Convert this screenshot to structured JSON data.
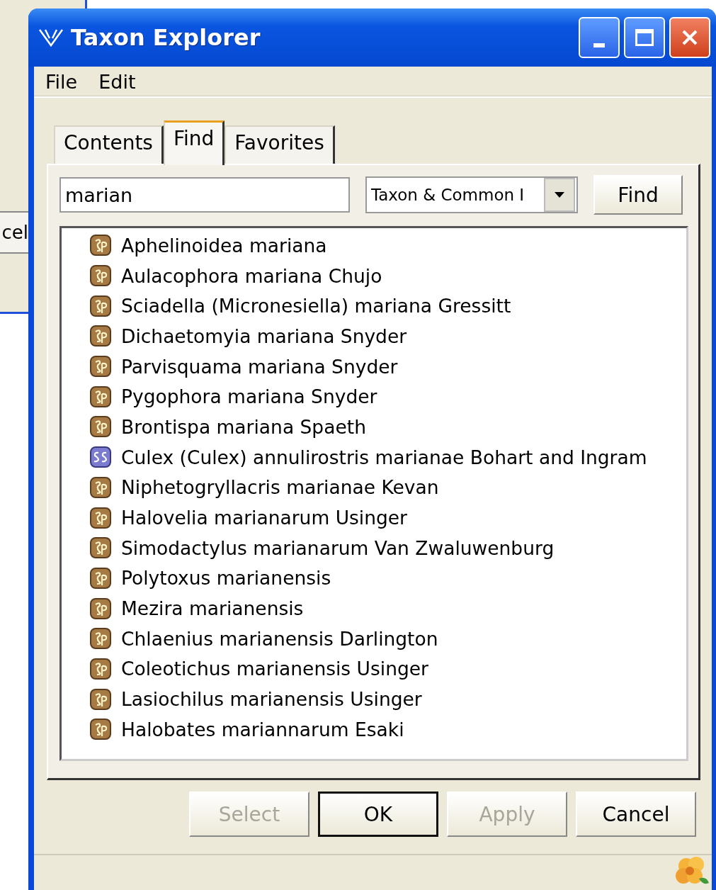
{
  "background_window": {
    "button_text": "cel"
  },
  "window": {
    "title": "Taxon Explorer"
  },
  "menu": [
    "File",
    "Edit"
  ],
  "tabs": [
    {
      "label": "Contents",
      "selected": false
    },
    {
      "label": "Find",
      "selected": true
    },
    {
      "label": "Favorites",
      "selected": false
    }
  ],
  "search": {
    "value": "marian"
  },
  "scope_dropdown": {
    "value": "Taxon & Common I"
  },
  "find_button": "Find",
  "results": [
    {
      "kind": "sp",
      "name": "Aphelinoidea mariana"
    },
    {
      "kind": "sp",
      "name": "Aulacophora mariana Chujo"
    },
    {
      "kind": "sp",
      "name": "Sciadella (Micronesiella) mariana Gressitt"
    },
    {
      "kind": "sp",
      "name": "Dichaetomyia mariana Snyder"
    },
    {
      "kind": "sp",
      "name": "Parvisquama mariana Snyder"
    },
    {
      "kind": "sp",
      "name": "Pygophora mariana Snyder"
    },
    {
      "kind": "sp",
      "name": "Brontispa mariana Spaeth"
    },
    {
      "kind": "ss",
      "name": "Culex (Culex) annulirostris marianae Bohart and Ingram"
    },
    {
      "kind": "sp",
      "name": "Niphetogryllacris marianae Kevan"
    },
    {
      "kind": "sp",
      "name": "Halovelia marianarum Usinger"
    },
    {
      "kind": "sp",
      "name": "Simodactylus marianarum Van Zwaluwenburg"
    },
    {
      "kind": "sp",
      "name": "Polytoxus marianensis"
    },
    {
      "kind": "sp",
      "name": "Mezira marianensis"
    },
    {
      "kind": "sp",
      "name": "Chlaenius marianensis Darlington"
    },
    {
      "kind": "sp",
      "name": "Coleotichus marianensis Usinger"
    },
    {
      "kind": "sp",
      "name": "Lasiochilus marianensis Usinger"
    },
    {
      "kind": "sp",
      "name": "Halobates mariannarum Esaki"
    }
  ],
  "buttons": [
    {
      "label": "Select",
      "disabled": true,
      "default": false
    },
    {
      "label": "OK",
      "disabled": false,
      "default": true
    },
    {
      "label": "Apply",
      "disabled": true,
      "default": false
    },
    {
      "label": "Cancel",
      "disabled": false,
      "default": false
    }
  ]
}
